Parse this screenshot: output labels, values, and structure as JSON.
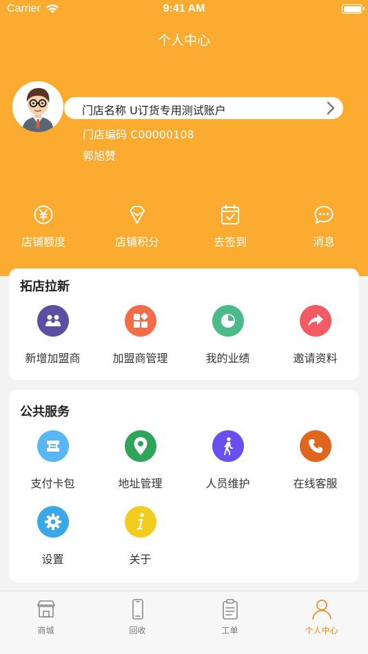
{
  "status_bar": {
    "carrier": "Carrier",
    "time": "9:41 AM"
  },
  "header": {
    "title": "个人中心",
    "store_name": "门店名称 U订货专用测试账户",
    "store_code": "门店编码 C00000108",
    "owner_name": "郭旭赞"
  },
  "quick_actions": [
    {
      "label": "店铺额度",
      "icon": "yuan-circle-icon"
    },
    {
      "label": "店铺积分",
      "icon": "gem-icon"
    },
    {
      "label": "去签到",
      "icon": "calendar-check-icon"
    },
    {
      "label": "消息",
      "icon": "chat-bubble-icon"
    }
  ],
  "expand_section": {
    "title": "拓店拉新",
    "items": [
      {
        "label": "新增加盟商",
        "icon": "add-partner-icon",
        "color": "#5b4ea3"
      },
      {
        "label": "加盟商管理",
        "icon": "manage-grid-icon",
        "color": "#f26e4a"
      },
      {
        "label": "我的业绩",
        "icon": "pie-chart-icon",
        "color": "#4cbb8a"
      },
      {
        "label": "邀请资料",
        "icon": "share-arrow-icon",
        "color": "#f25b64"
      }
    ]
  },
  "public_section": {
    "title": "公共服务",
    "items": [
      {
        "label": "支付卡包",
        "icon": "card-wallet-icon",
        "color": "#58b6f2"
      },
      {
        "label": "地址管理",
        "icon": "location-pin-icon",
        "color": "#2fa55a"
      },
      {
        "label": "人员维护",
        "icon": "walking-person-icon",
        "color": "#6a4ff0"
      },
      {
        "label": "在线客服",
        "icon": "phone-icon",
        "color": "#e0661d"
      },
      {
        "label": "设置",
        "icon": "gear-icon",
        "color": "#3aa7e8"
      },
      {
        "label": "关于",
        "icon": "info-icon",
        "color": "#f3cc20"
      }
    ]
  },
  "tabbar": {
    "tabs": [
      {
        "label": "商城",
        "icon": "store-icon",
        "active": false
      },
      {
        "label": "回收",
        "icon": "phone-device-icon",
        "active": false
      },
      {
        "label": "工单",
        "icon": "clipboard-icon",
        "active": false
      },
      {
        "label": "个人中心",
        "icon": "person-icon",
        "active": true
      }
    ]
  },
  "colors": {
    "brand": "#fbab2f",
    "active_tab": "#f08c1e",
    "background": "#f3f3f3"
  }
}
